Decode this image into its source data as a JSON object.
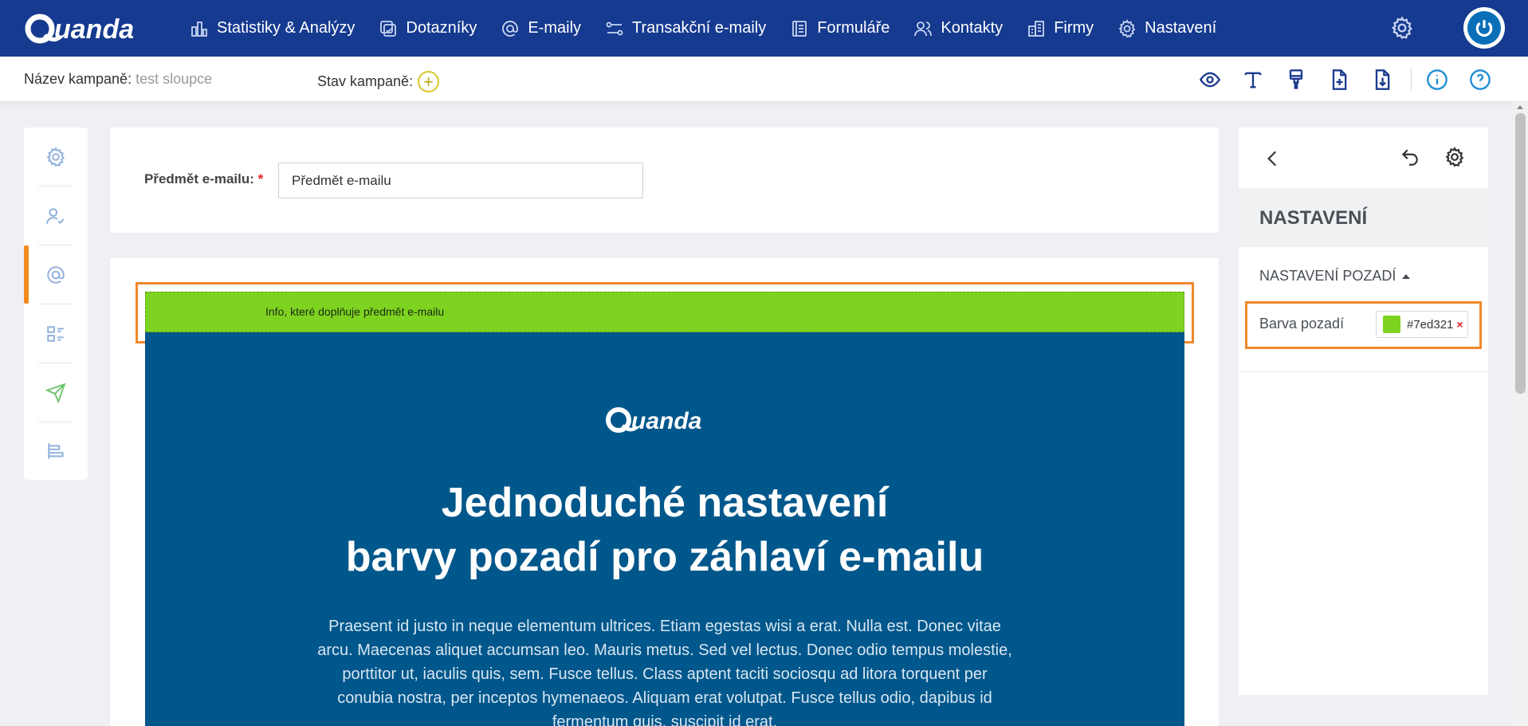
{
  "brand": {
    "name": "Quanda",
    "nav_bg": "#163a8f",
    "accent": "#f58a1f",
    "email_bg": "#00578b",
    "preheader_bg": "#7ed321"
  },
  "nav": {
    "items": [
      {
        "label": "Statistiky & Analýzy",
        "icon": "bar-chart-icon"
      },
      {
        "label": "Dotazníky",
        "icon": "survey-icon"
      },
      {
        "label": "E-maily",
        "icon": "at-icon"
      },
      {
        "label": "Transakční e-maily",
        "icon": "flow-icon"
      },
      {
        "label": "Formuláře",
        "icon": "form-icon"
      },
      {
        "label": "Kontakty",
        "icon": "contacts-icon"
      },
      {
        "label": "Firmy",
        "icon": "building-icon"
      },
      {
        "label": "Nastavení",
        "icon": "gear-icon"
      }
    ]
  },
  "campaign": {
    "name_label": "Název kampaně:",
    "name_value": "test sloupce",
    "state_label": "Stav kampaně:",
    "state_add": "+"
  },
  "toolbar": {
    "icons": [
      "eye-icon",
      "text-icon",
      "brush-icon",
      "add-file-icon",
      "download-file-icon",
      "info-icon",
      "help-icon"
    ]
  },
  "rail": {
    "icons": [
      "gear-icon",
      "user-check-icon",
      "at-icon",
      "layout-icon",
      "send-icon",
      "align-icon"
    ],
    "active": "at-icon"
  },
  "subject": {
    "label": "Předmět e-mailu:",
    "required_mark": "*",
    "value": "Předmět e-mailu"
  },
  "email": {
    "preheader": "Info, které doplňuje předmět e-mailu",
    "logo": "Quanda",
    "title_line1": "Jednoduché nastavení",
    "title_line2": "barvy pozadí pro záhlaví e-mailu",
    "body": "Praesent id justo in neque elementum ultrices. Etiam egestas wisi a erat. Nulla est. Donec vitae arcu. Maecenas aliquet accumsan leo. Mauris metus. Sed vel lectus. Donec odio tempus molestie, porttitor ut, iaculis quis, sem. Fusce tellus. Class aptent taciti sociosqu ad litora torquent per conubia nostra, per inceptos hymenaeos. Aliquam erat volutpat. Fusce tellus odio, dapibus id fermentum quis, suscipit id erat."
  },
  "settings": {
    "heading": "NASTAVENÍ",
    "section": "NASTAVENÍ POZADÍ",
    "bg_label": "Barva pozadí",
    "bg_value": "#7ed321",
    "bg_display": "#7ed321",
    "clear": "×"
  }
}
